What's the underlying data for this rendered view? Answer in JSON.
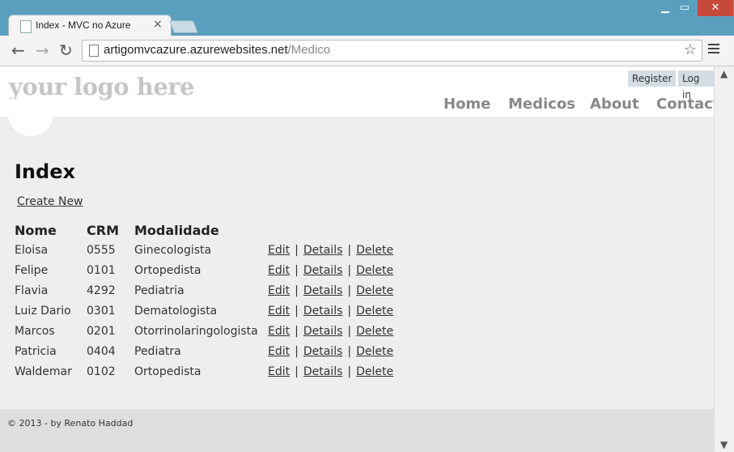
{
  "browser": {
    "tab_title": "Index - MVC no Azure",
    "url_host": "artigomvcazure.azurewebsites.net",
    "url_path": "/Medico"
  },
  "header": {
    "logo_text": "your logo here",
    "register_label": "Register",
    "login_label": "Log in",
    "menu": [
      "Home",
      "Medicos",
      "About",
      "Contact"
    ]
  },
  "main": {
    "title": "Index",
    "create_new_label": "Create New",
    "columns": [
      "Nome",
      "CRM",
      "Modalidade"
    ],
    "rows": [
      {
        "nome": "Eloisa",
        "crm": "0555",
        "modalidade": "Ginecologista"
      },
      {
        "nome": "Felipe",
        "crm": "0101",
        "modalidade": "Ortopedista"
      },
      {
        "nome": "Flavia",
        "crm": "4292",
        "modalidade": "Pediatria"
      },
      {
        "nome": "Luiz Dario",
        "crm": "0301",
        "modalidade": "Dematologista"
      },
      {
        "nome": "Marcos",
        "crm": "0201",
        "modalidade": "Otorrinolaringologista"
      },
      {
        "nome": "Patricia",
        "crm": "0404",
        "modalidade": "Pediatra"
      },
      {
        "nome": "Waldemar",
        "crm": "0102",
        "modalidade": "Ortopedista"
      }
    ],
    "actions": {
      "edit": "Edit",
      "details": "Details",
      "delete": "Delete",
      "separator": "|"
    }
  },
  "footer": {
    "text": "© 2013 - by Renato Haddad"
  }
}
